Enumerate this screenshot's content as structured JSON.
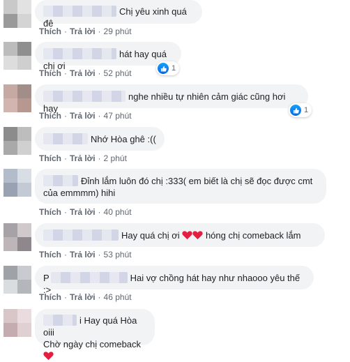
{
  "ui": {
    "like_label": "Thích",
    "reply_label": "Trả lời",
    "separator": "·"
  },
  "comments": [
    {
      "text": "Chị yêu xinh quá đê",
      "time": "29 phút",
      "reactions": ""
    },
    {
      "text": "hát hay quá chị ơi",
      "time": "52 phút",
      "reactions": "1"
    },
    {
      "text": "nghe nhiều tự nhiên cảm giác cũng hơi hay",
      "time": "47 phút",
      "reactions": "1"
    },
    {
      "text": "Nhớ Hòa ghê :((",
      "time": "2 phút",
      "reactions": ""
    },
    {
      "line1": "Đỉnh lắm luôn đó chị :333( em biết là chị sẽ đọc được cmt",
      "line2": "của emmmm) hihi",
      "time": "40 phút",
      "reactions": ""
    },
    {
      "text_a": "Hay quá chị ơi",
      "text_b": "hóng chị comeback lắm",
      "time": "53 phút",
      "reactions": ""
    },
    {
      "author_initial": "P",
      "text": "Hai vợ chồng hát hay như nhaooo yêu thế :>",
      "time": "46 phút",
      "reactions": ""
    },
    {
      "line1": "i Hay quá Hòa oiii",
      "line2": "Chờ ngày chị comeback",
      "time": "",
      "reactions": ""
    }
  ],
  "colors": {
    "bubble": "#f2f3f5",
    "link": "#606770",
    "like_blue": "#1877f2",
    "heart_red": "#e41e3f"
  }
}
